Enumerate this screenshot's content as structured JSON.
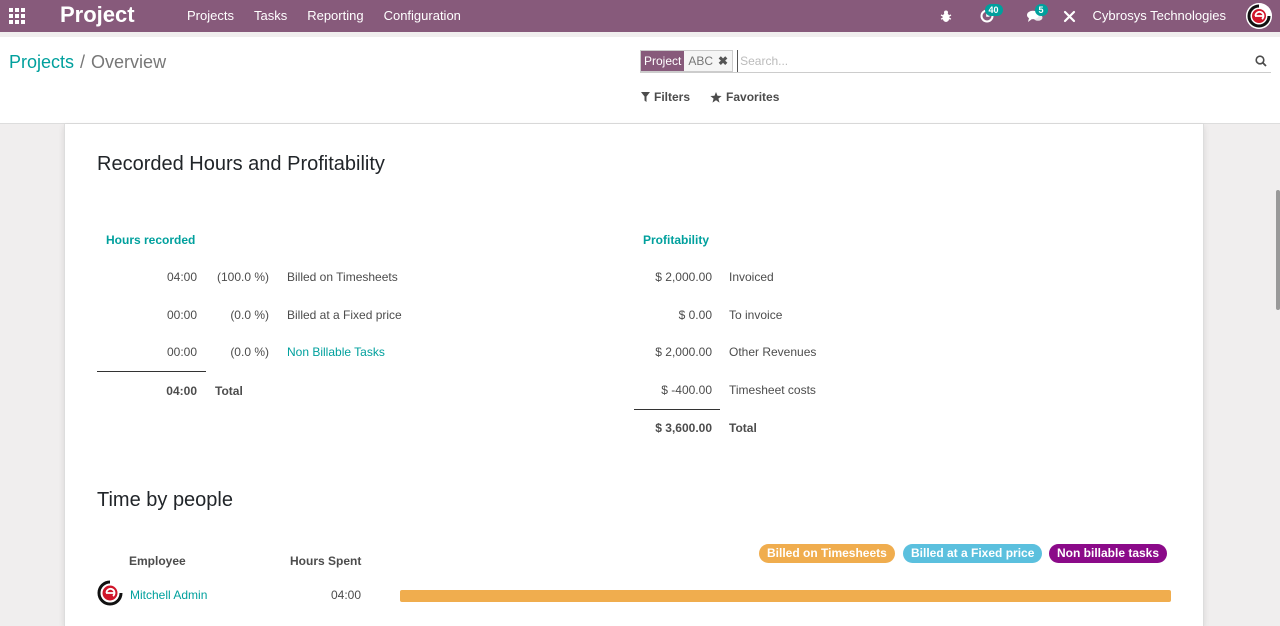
{
  "navbar": {
    "app_name": "Project",
    "menu": [
      "Projects",
      "Tasks",
      "Reporting",
      "Configuration"
    ],
    "activity_count": "40",
    "messages_count": "5",
    "company": "Cybrosys Technologies"
  },
  "breadcrumb": {
    "parent": "Projects",
    "separator": "/",
    "current": "Overview"
  },
  "search": {
    "facet_label": "Project",
    "facet_value": "ABC",
    "placeholder": "Search...",
    "filters_label": "Filters",
    "favorites_label": "Favorites"
  },
  "hours_section": {
    "title": "Recorded Hours and Profitability",
    "hours_header": "Hours recorded",
    "hours_rows": [
      {
        "hours": "04:00",
        "percent": "(100.0 %)",
        "label": "Billed on Timesheets"
      },
      {
        "hours": "00:00",
        "percent": "(0.0 %)",
        "label": "Billed at a Fixed price"
      },
      {
        "hours": "00:00",
        "percent": "(0.0 %)",
        "label": "Non Billable Tasks"
      }
    ],
    "hours_total": {
      "hours": "04:00",
      "label": "Total"
    },
    "profit_header": "Profitability",
    "profit_rows": [
      {
        "amount": "$ 2,000.00",
        "label": "Invoiced"
      },
      {
        "amount": "$ 0.00",
        "label": "To invoice"
      },
      {
        "amount": "$ 2,000.00",
        "label": "Other Revenues"
      },
      {
        "amount": "$ -400.00",
        "label": "Timesheet costs"
      }
    ],
    "profit_total": {
      "amount": "$ 3,600.00",
      "label": "Total"
    }
  },
  "people_section": {
    "title": "Time by people",
    "employee_header": "Employee",
    "hours_header": "Hours Spent",
    "legend": [
      {
        "label": "Billed on Timesheets",
        "color": "#f0ad4e"
      },
      {
        "label": "Billed at a Fixed price",
        "color": "#5bc0de"
      },
      {
        "label": "Non billable tasks",
        "color": "#8b0a89"
      }
    ],
    "rows": [
      {
        "employee": "Mitchell Admin",
        "hours": "04:00",
        "billed_timesheets_share": 1.0
      }
    ]
  }
}
